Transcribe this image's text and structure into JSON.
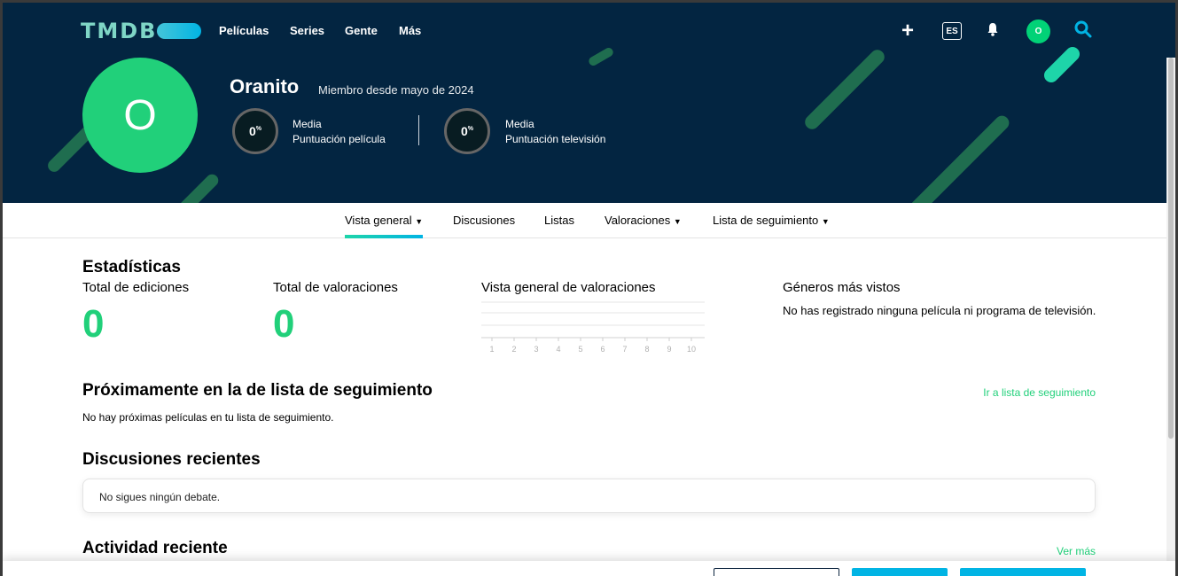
{
  "header": {
    "logo": "TMDB",
    "nav": [
      "Películas",
      "Series",
      "Gente",
      "Más"
    ],
    "language": "ES",
    "user_initial": "O"
  },
  "profile": {
    "initial": "O",
    "username": "Oranito",
    "member_since": "Miembro desde mayo de 2024",
    "scores": [
      {
        "value": "0",
        "unit": "%",
        "label_line1": "Media",
        "label_line2": "Puntuación película"
      },
      {
        "value": "0",
        "unit": "%",
        "label_line1": "Media",
        "label_line2": "Puntuación televisión"
      }
    ]
  },
  "subnav": {
    "items": [
      "Vista general",
      "Discusiones",
      "Listas",
      "Valoraciones",
      "Lista de seguimiento"
    ],
    "dropdown_arrow": "▼"
  },
  "stats": {
    "title": "Estadísticas",
    "total_edits_label": "Total de ediciones",
    "total_edits": "0",
    "total_ratings_label": "Total de valoraciones",
    "total_ratings": "0",
    "ratings_overview_label": "Vista general de valoraciones",
    "ratings_axis": [
      "1",
      "2",
      "3",
      "4",
      "5",
      "6",
      "7",
      "8",
      "9",
      "10"
    ],
    "genres_label": "Géneros más vistos",
    "genres_note": "No has registrado ninguna película ni programa de televisión."
  },
  "upcoming": {
    "title": "Próximamente en la de lista de seguimiento",
    "link": "Ir a lista de seguimiento",
    "empty": "No hay próximas películas en tu lista de seguimiento."
  },
  "discussions": {
    "title": "Discusiones recientes",
    "empty": "No sigues ningún debate."
  },
  "activity": {
    "title": "Actividad reciente",
    "link": "Ver más"
  },
  "colors": {
    "header_bg": "#032541",
    "accent_green": "#21d07a",
    "accent_blue": "#01b4e4"
  }
}
